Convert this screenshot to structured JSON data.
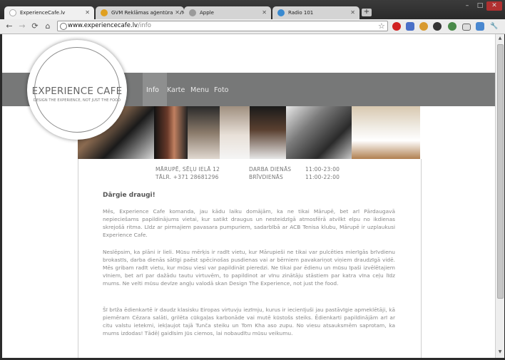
{
  "tabs": [
    {
      "title": "ExperienceCafe.lv",
      "active": true,
      "favicon_color": "#ffffff"
    },
    {
      "title": "GVM Reklāmas aģentūra GVM | ...",
      "active": false,
      "favicon_color": "#e0a020"
    },
    {
      "title": "Apple",
      "active": false,
      "favicon_color": "#9a9a9a"
    },
    {
      "title": "Radio 101",
      "active": false,
      "favicon_color": "#3a8ad0"
    }
  ],
  "new_tab_label": "+",
  "window_controls": {
    "minimize": "–",
    "maximize": "□",
    "close": "✕"
  },
  "toolbar": {
    "back_icon": "←",
    "forward_icon": "→",
    "reload_icon": "⟳",
    "home_icon": "⌂",
    "star_icon": "☆",
    "wrench_icon": "🔧"
  },
  "address": {
    "host": "www.experiencecafe.lv",
    "path": "/info"
  },
  "site": {
    "logo_title": "EXPERIENCE CAFE",
    "logo_tagline": "DESIGN THE EXPERIENCE, NOT JUST THE FOOD",
    "nav": [
      "Info",
      "Karte",
      "Menu",
      "Foto"
    ],
    "active_nav": "Info",
    "address_line1": "MĀRUPĒ, SĒĻU IELĀ 12",
    "address_line2": "TĀLR. +371 28681296",
    "hours_label1": "DARBA DIENĀS",
    "hours_value1": "11:00-23:00",
    "hours_label2": "BRĪVDIENĀS",
    "hours_value2": "11:00-22:00",
    "greeting": "Dārgie draugi!",
    "paragraphs": [
      "Mēs, Experience Cafe komanda, jau kādu laiku domājām, ka ne tikai Mārupē, bet arī Pārdaugavā nepieciešams papildinājums vietai, kur satikt draugus un nesteidzīgā atmosfērā atvilkt elpu no ikdienas skrejošā ritma. Līdz ar pirmajiem pavasara pumpuriem, sadarbībā ar ACB Tenisa klubu, Mārupē ir uzplaukusi Experience Cafe.",
      "Neslēpsim, ka plāni ir lieli. Mūsu mērķis ir radīt vietu, kur Mārupieši ne tikai var pulcēties mierīgās brīvdienu brokastīs, darba dienās sātīgi paēst spēcinošas pusdienas vai ar bērniem pavakariņot viņiem draudzīgā vidē. Mēs gribam radīt vietu, kur mūsu viesi var papildināt pieredzi. Ne tikai par ēdienu un mūsu īpaši izvēlētajiem vīniem, bet arī par dažādu tautu virtuvēm, to papildinot ar vīnu zinātāju stāstiem par katra vīna ceļu līdz mums. Ne velti mūsu devīze angļu valodā skan Design The Experience, not just the food.",
      "Šī brīža ēdienkartē ir daudz klasisku Eiropas virtuvju iezīmju, kurus ir iecienījuši jau pastāvīgie apmeklētāji, kā piemēram Cēzara salāti, grilēta cūkgaļas karbonāde vai mutē kūstošs steiks. Ēdienkarti papildinājām arī ar citu valstu ietekmi, iekļaujot tajā Tunča steiku un Tom Kha aso zupu. No viesu atsauksmēm saprotam, ka mums izdodas! Tādēļ gaidīsim Jūs ciemos, lai nobaudītu mūsu veikumu."
    ]
  },
  "colors": {
    "band": "#777878",
    "active_nav": "#8e8f8f",
    "text": "#888888"
  }
}
